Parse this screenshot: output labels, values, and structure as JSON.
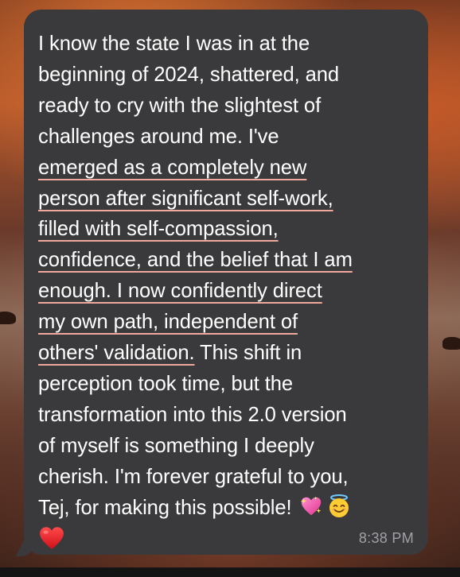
{
  "message": {
    "lines": [
      {
        "segments": [
          {
            "text": "I know the state I was in at the",
            "highlight": false
          }
        ]
      },
      {
        "segments": [
          {
            "text": "beginning of 2024, shattered, and",
            "highlight": false
          }
        ]
      },
      {
        "segments": [
          {
            "text": "ready to cry with the slightest of",
            "highlight": false
          }
        ]
      },
      {
        "segments": [
          {
            "text": "challenges around me. I've",
            "highlight": false
          }
        ]
      },
      {
        "segments": [
          {
            "text": "emerged as a completely new",
            "highlight": true
          }
        ]
      },
      {
        "segments": [
          {
            "text": "person after significant self-work,",
            "highlight": true
          }
        ]
      },
      {
        "segments": [
          {
            "text": "filled with self-compassion,",
            "highlight": true
          }
        ]
      },
      {
        "segments": [
          {
            "text": "confidence, and the belief that I am",
            "highlight": true
          }
        ]
      },
      {
        "segments": [
          {
            "text": "enough. I now confidently direct",
            "highlight": true
          }
        ]
      },
      {
        "segments": [
          {
            "text": "my own path, independent of",
            "highlight": true
          }
        ]
      },
      {
        "segments": [
          {
            "text": "others' validation.",
            "highlight": true
          },
          {
            "text": " This shift in",
            "highlight": false
          }
        ]
      },
      {
        "segments": [
          {
            "text": "perception took time, but the",
            "highlight": false
          }
        ]
      },
      {
        "segments": [
          {
            "text": "transformation into this 2.0 version",
            "highlight": false
          }
        ]
      },
      {
        "segments": [
          {
            "text": "of myself is something I deeply",
            "highlight": false
          }
        ]
      },
      {
        "segments": [
          {
            "text": "cherish. I'm forever grateful to you,",
            "highlight": false
          }
        ]
      },
      {
        "segments": [
          {
            "text": "Tej, for making this possible! ",
            "highlight": false
          }
        ]
      }
    ],
    "emojis": [
      "sparkling-heart-icon",
      "smiling-face-with-halo-icon",
      "red-heart-icon"
    ],
    "timestamp": "8:38 PM"
  },
  "colors": {
    "bubble": "#3a3a3c",
    "text": "#ffffff",
    "highlight_underline": "#f0a79e",
    "timestamp": "#a0a0a6"
  }
}
